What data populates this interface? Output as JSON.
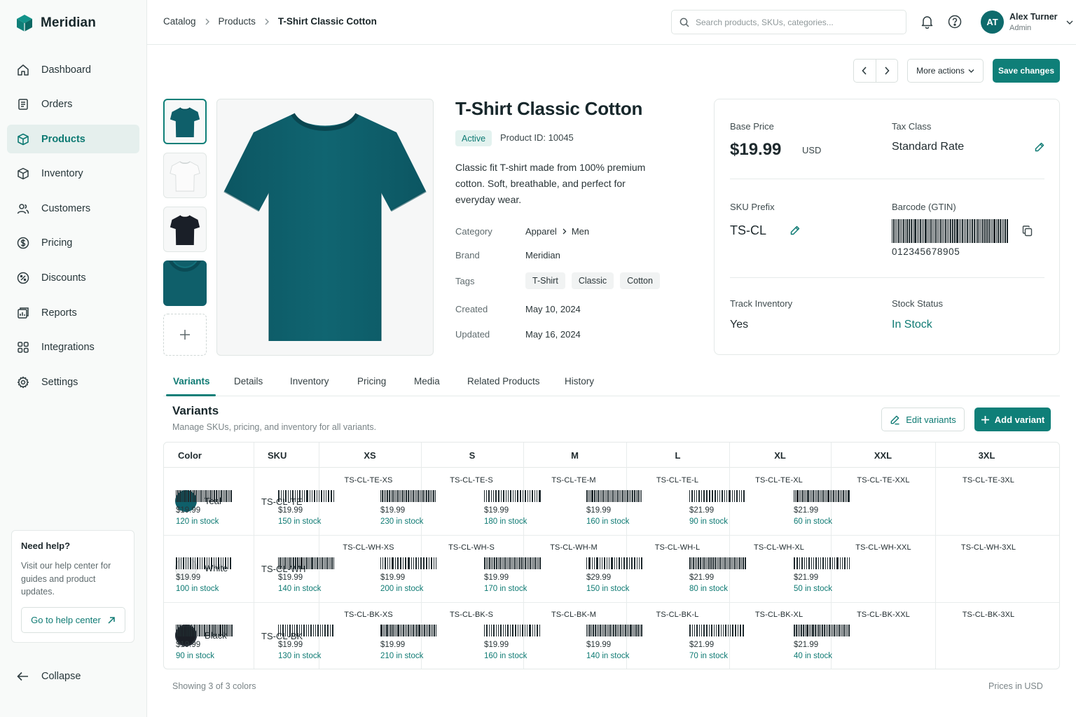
{
  "app": {
    "name": "Meridian"
  },
  "sidebar": {
    "items": [
      {
        "label": "Dashboard",
        "icon": "home-icon",
        "active": false
      },
      {
        "label": "Orders",
        "icon": "orders-icon",
        "active": false
      },
      {
        "label": "Products",
        "icon": "box-icon",
        "active": true
      },
      {
        "label": "Inventory",
        "icon": "inventory-icon",
        "active": false
      },
      {
        "label": "Customers",
        "icon": "users-icon",
        "active": false
      },
      {
        "label": "Pricing",
        "icon": "dollar-icon",
        "active": false
      },
      {
        "label": "Discounts",
        "icon": "discount-icon",
        "active": false
      },
      {
        "label": "Reports",
        "icon": "reports-icon",
        "active": false
      },
      {
        "label": "Integrations",
        "icon": "integrations-icon",
        "active": false
      },
      {
        "label": "Settings",
        "icon": "gear-icon",
        "active": false
      }
    ],
    "help": {
      "title": "Need help?",
      "text": "Visit our help center for guides and product updates.",
      "button": "Go to help center"
    },
    "collapse_label": "Collapse"
  },
  "header": {
    "breadcrumbs": [
      "Catalog",
      "Products",
      "T-Shirt Classic Cotton"
    ],
    "search_placeholder": "Search products, SKUs, categories...",
    "user": {
      "initials": "AT",
      "name": "Alex Turner",
      "role": "Admin"
    }
  },
  "actions": {
    "more_label": "More actions",
    "save_label": "Save changes"
  },
  "product": {
    "title": "T-Shirt Classic Cotton",
    "status": "Active",
    "id_text": "Product ID: 10045",
    "description": "Classic fit T-shirt made from 100% premium cotton. Soft, breathable, and perfect for everyday wear.",
    "meta": {
      "category_label": "Category",
      "category": [
        "Apparel",
        "Men"
      ],
      "brand_label": "Brand",
      "brand": "Meridian",
      "tags_label": "Tags",
      "tags": [
        "T-Shirt",
        "Classic",
        "Cotton"
      ],
      "created_label": "Created",
      "created": "May 10, 2024",
      "updated_label": "Updated",
      "updated": "May 16, 2024"
    },
    "images": [
      {
        "color": "#0f5f6a"
      },
      {
        "color": "#eeeeee"
      },
      {
        "color": "#1a1f28"
      },
      {
        "color": "#0f5f6a"
      }
    ]
  },
  "info": {
    "base_price_label": "Base Price",
    "base_price": "$19.99",
    "currency": "USD",
    "tax_class_label": "Tax Class",
    "tax_class": "Standard Rate",
    "sku_prefix_label": "SKU Prefix",
    "sku_prefix": "TS-CL",
    "barcode_label": "Barcode (GTIN)",
    "barcode": "012345678905",
    "track_label": "Track Inventory",
    "track": "Yes",
    "stock_status_label": "Stock Status",
    "stock_status": "In Stock"
  },
  "tabs": [
    "Variants",
    "Details",
    "Inventory",
    "Pricing",
    "Media",
    "Related Products",
    "History"
  ],
  "variants": {
    "title": "Variants",
    "subtitle": "Manage SKUs, pricing, and inventory for all variants.",
    "edit_label": "Edit variants",
    "add_label": "Add variant",
    "headers": [
      "Color",
      "SKU",
      "XS",
      "S",
      "M",
      "L",
      "XL",
      "XXL",
      "3XL"
    ],
    "rows": [
      {
        "color": "Teal",
        "swatch": "#0f5f6a",
        "sku": "TS-CL-TE",
        "cells": [
          {
            "sku": "TS-CL-TE-XS",
            "price": "$19.99",
            "stock": "120 in stock"
          },
          {
            "sku": "TS-CL-TE-S",
            "price": "$19.99",
            "stock": "150 in stock"
          },
          {
            "sku": "TS-CL-TE-M",
            "price": "$19.99",
            "stock": "230 in stock"
          },
          {
            "sku": "TS-CL-TE-L",
            "price": "$19.99",
            "stock": "180 in stock"
          },
          {
            "sku": "TS-CL-TE-XL",
            "price": "$19.99",
            "stock": "160 in stock"
          },
          {
            "sku": "TS-CL-TE-XXL",
            "price": "$21.99",
            "stock": "90 in stock"
          },
          {
            "sku": "TS-CL-TE-3XL",
            "price": "$21.99",
            "stock": "60 in stock"
          }
        ]
      },
      {
        "color": "White",
        "swatch": "#f4f5f5",
        "sku": "TS-CL-WH",
        "cells": [
          {
            "sku": "TS-CL-WH-XS",
            "price": "$19.99",
            "stock": "100 in stock"
          },
          {
            "sku": "TS-CL-WH-S",
            "price": "$19.99",
            "stock": "140 in stock"
          },
          {
            "sku": "TS-CL-WH-M",
            "price": "$19.99",
            "stock": "200 in stock"
          },
          {
            "sku": "TS-CL-WH-L",
            "price": "$19.99",
            "stock": "170 in stock"
          },
          {
            "sku": "TS-CL-WH-XL",
            "price": "$29.99",
            "stock": "150 in stock"
          },
          {
            "sku": "TS-CL-WH-XXL",
            "price": "$21.99",
            "stock": "80 in stock"
          },
          {
            "sku": "TS-CL-WH-3XL",
            "price": "$21.99",
            "stock": "50 in stock"
          }
        ]
      },
      {
        "color": "Black",
        "swatch": "#1b1f26",
        "sku": "TS-CL-BK",
        "cells": [
          {
            "sku": "TS-CL-BK-XS",
            "price": "$19.99",
            "stock": "90 in stock"
          },
          {
            "sku": "TS-CL-BK-S",
            "price": "$19.99",
            "stock": "130 in stock"
          },
          {
            "sku": "TS-CL-BK-M",
            "price": "$19.99",
            "stock": "210 in stock"
          },
          {
            "sku": "TS-CL-BK-L",
            "price": "$19.99",
            "stock": "160 in stock"
          },
          {
            "sku": "TS-CL-BK-XL",
            "price": "$19.99",
            "stock": "140 in stock"
          },
          {
            "sku": "TS-CL-BK-XXL",
            "price": "$21.99",
            "stock": "70 in stock"
          },
          {
            "sku": "TS-CL-BK-3XL",
            "price": "$21.99",
            "stock": "40 in stock"
          }
        ]
      }
    ],
    "footer_left": "Showing 3 of 3 colors",
    "footer_right": "Prices in USD"
  },
  "colors": {
    "accent": "#0f7f78",
    "accent_text": "#0e7a73",
    "active_bg": "#e5efed"
  }
}
